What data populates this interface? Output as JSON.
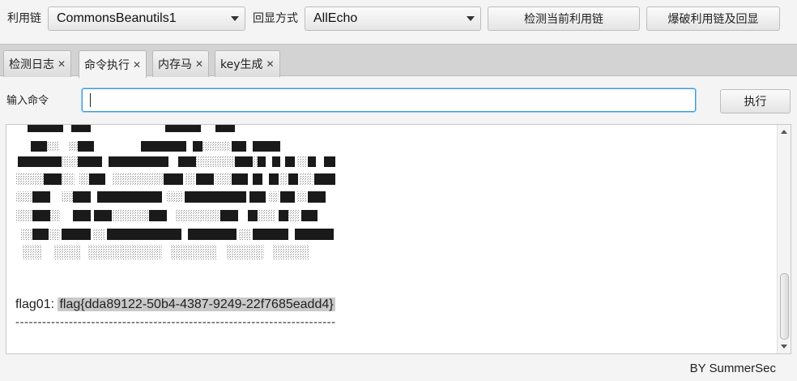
{
  "toolbar": {
    "chain_label": "利用链",
    "chain_value": "CommonsBeanutils1",
    "echo_label": "回显方式",
    "echo_value": "AllEcho",
    "detect_button": "检测当前利用链",
    "brute_button": "爆破利用链及回显"
  },
  "tabs": [
    {
      "label": "检测日志",
      "active": false
    },
    {
      "label": "命令执行",
      "active": true
    },
    {
      "label": "内存马",
      "active": false
    },
    {
      "label": "key生成",
      "active": false
    }
  ],
  "command": {
    "label": "输入命令",
    "value": "",
    "execute_button": "执行"
  },
  "output": {
    "flag_prefix": "flag01: ",
    "flag_value": "flag{dda89122-50b4-4387-9249-22f7685eadd4}",
    "separator": "------------------------------------------------------------------------"
  },
  "footer": {
    "by": "BY   SummerSec"
  },
  "icons": {
    "close": "close-icon",
    "dropdown": "chevron-down-icon"
  },
  "colors": {
    "focus_border": "#3a9ad9",
    "flag_highlight": "#c9c9c9",
    "art_block": "#1a1a1a"
  }
}
